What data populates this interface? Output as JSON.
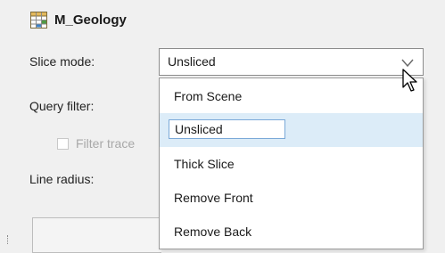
{
  "header": {
    "title": "M_Geology",
    "icon": "table-icon"
  },
  "form": {
    "slice_mode_label": "Slice mode:",
    "query_filter_label": "Query filter:",
    "filter_trace_label": "Filter trace",
    "line_radius_label": "Line radius:",
    "slice_mode_value": "Unsliced"
  },
  "dropdown": {
    "options": [
      "From Scene",
      "Unsliced",
      "Thick Slice",
      "Remove Front",
      "Remove Back"
    ],
    "selected": "Unsliced"
  },
  "colors": {
    "background": "#f0f0f0",
    "selection_fill": "#dcecf8",
    "selection_border": "#7aa9d8",
    "disabled_text": "#a8a8a8"
  }
}
